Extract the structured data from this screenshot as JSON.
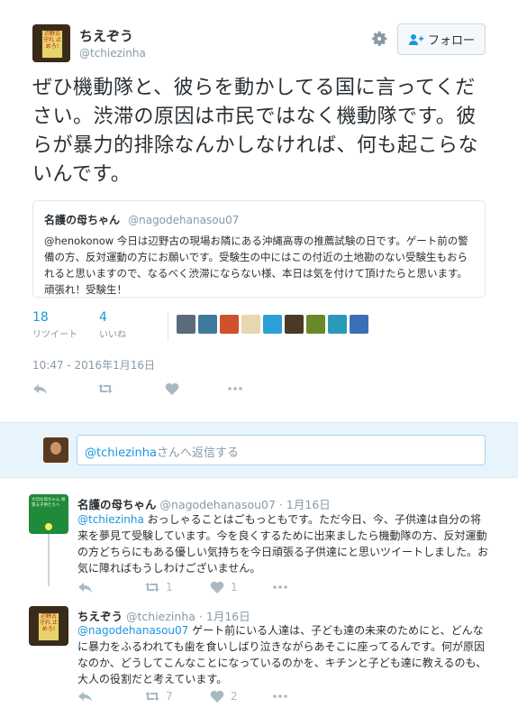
{
  "tweet": {
    "user_name": "ちえぞう",
    "user_handle": "@tchiezinha",
    "avatar_sign": "辺野古 守れ 止めろ!",
    "follow_label": "フォロー",
    "text": "ぜひ機動隊と、彼らを動かしてる国に言ってください。渋滞の原因は市民ではなく機動隊です。彼らが暴力的排除なんかしなければ、何も起こらないんです。",
    "quote": {
      "name": "名護の母ちゃん",
      "handle": "@nagodehanasou07",
      "text": "@henokonow 今日は辺野古の現場お隣にある沖縄高専の推薦試験の日です。ゲート前の警備の方、反対運動の方にお願いです。受験生の中にはこの付近の土地勘のない受験生もおられると思いますので、なるべく渋滞にならない様、本日は気を付けて頂けたらと思います。頑張れ！受験生！"
    },
    "retweets_count": "18",
    "retweets_label": "リツイート",
    "likes_count": "4",
    "likes_label": "いいね",
    "timestamp": "10:47 - 2016年1月16日"
  },
  "reply_box": {
    "mention": "@tchiezinha",
    "placeholder_suffix": "さんへ返信する"
  },
  "replies": [
    {
      "name": "名護の母ちゃん",
      "handle": "@nagodehanasou07",
      "date": "· 1月16日",
      "avatar_text": "大切な母ちゃん 頑張る子供たちへ",
      "mention": "@tchiezinha",
      "text": " おっしゃることはごもっともです。ただ今日、今、子供達は自分の将来を夢見て受験しています。今を良くするために出来ましたら機動隊の方、反対運動の方どちらにもある優しい気持ちを今日頑張る子供達にと思いツイートしました。お気に障ればもうしわけございません。",
      "retweets": "1",
      "likes": "1"
    },
    {
      "name": "ちえぞう",
      "handle": "@tchiezinha",
      "date": "· 1月16日",
      "mention": "@nagodehanasou07",
      "text": " ゲート前にいる人達は、子ども達の未来のためにと、どんなに暴力をふるわれても歯を食いしばり泣きながらあそこに座ってるんです。何が原因なのか、どうしてこんなことになっているのかを、キチンと子ども達に教えるのも、大人の役割だと考えています。",
      "retweets": "7",
      "likes": "2"
    }
  ],
  "colors": {
    "accent": "#1b95e0",
    "muted": "#8899a6",
    "icon": "#aab8c2",
    "reply_bg": "#e8f4fb"
  },
  "likers": [
    "#5b6b7a",
    "#3f7a9e",
    "#d0522a",
    "#e8d8b0",
    "#2d9fd8",
    "#4a3a28",
    "#6a8a2a",
    "#2a9ab8",
    "#3c6fb8"
  ]
}
